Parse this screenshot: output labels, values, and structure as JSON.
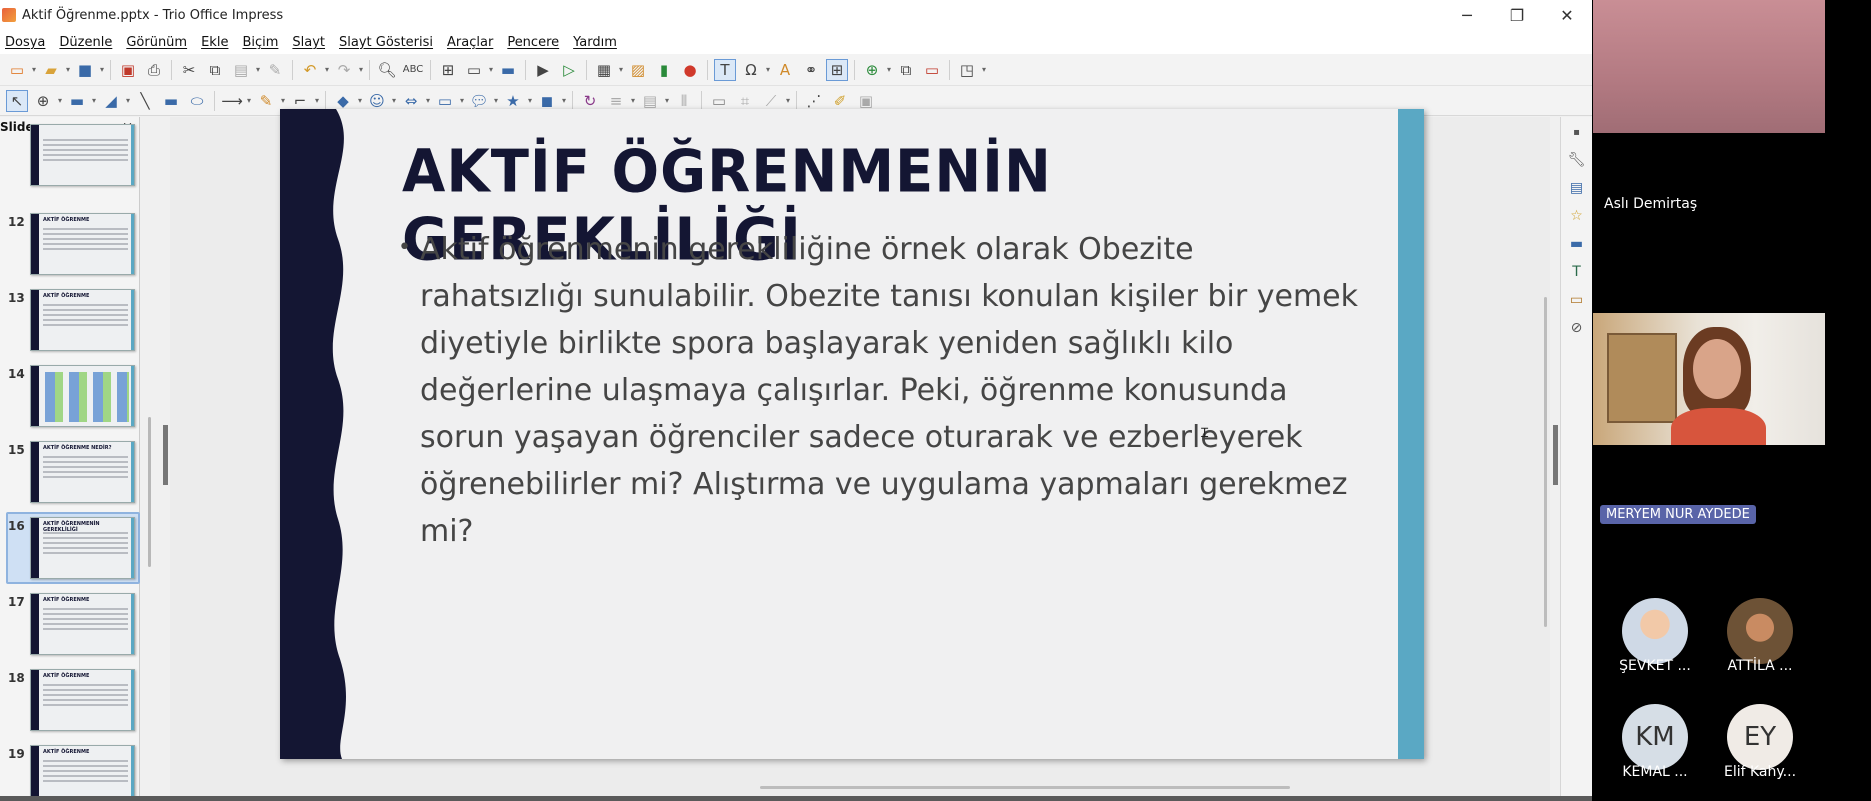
{
  "window": {
    "title": "Aktif Öğrenme.pptx - Trio Office Impress",
    "controls": {
      "minimize": "─",
      "restore": "❐",
      "close": "✕"
    }
  },
  "menu": [
    "Dosya",
    "Düzenle",
    "Görünüm",
    "Ekle",
    "Biçim",
    "Slayt",
    "Slayt Gösterisi",
    "Araçlar",
    "Pencere",
    "Yardım"
  ],
  "slides_panel": {
    "title": "Slides",
    "close": "×",
    "thumbnails": [
      {
        "number": "",
        "title": ""
      },
      {
        "number": "12",
        "title": "AKTİF ÖĞRENME"
      },
      {
        "number": "13",
        "title": "AKTİF ÖĞRENME"
      },
      {
        "number": "14",
        "title": ""
      },
      {
        "number": "15",
        "title": "AKTİF ÖĞRENME NEDİR?"
      },
      {
        "number": "16",
        "title": "AKTİF ÖĞRENMENİN GEREKLİLİĞİ"
      },
      {
        "number": "17",
        "title": "AKTİF ÖĞRENME"
      },
      {
        "number": "18",
        "title": "AKTİF ÖĞRENME"
      },
      {
        "number": "19",
        "title": "AKTİF ÖĞRENME"
      }
    ],
    "selected": "16"
  },
  "slide": {
    "title": "AKTİF ÖĞRENMENİN GEREKLİLİĞİ",
    "bullet": "Aktif öğrenmenin gerekliliğine örnek olarak Obezite rahatsızlığı sunulabilir. Obezite tanısı konulan kişiler bir yemek diyetiyle birlikte spora başlayarak yeniden sağlıklı kilo değerlerine ulaşmaya çalışırlar. Peki, öğrenme konusunda sorun yaşayan öğrenciler sadece oturarak ve ezberleyerek öğrenebilirler mi? Alıştırma ve uygulama yapmaları gerekmez mi?",
    "colors": {
      "dark_band": "#141633",
      "accent_band": "#5aa8c4",
      "title": "#141633",
      "text": "#454545"
    }
  },
  "meeting": {
    "participants": [
      {
        "name": "Aslı Demirtaş"
      },
      {
        "name": "MERYEM NUR AYDEDE"
      },
      {
        "name": "ŞEVKET ..."
      },
      {
        "name": "ATTİLA ..."
      },
      {
        "name": "KEMAL ...",
        "initials": "KM"
      },
      {
        "name": "Elif Kahy...",
        "initials": "EY"
      }
    ]
  }
}
